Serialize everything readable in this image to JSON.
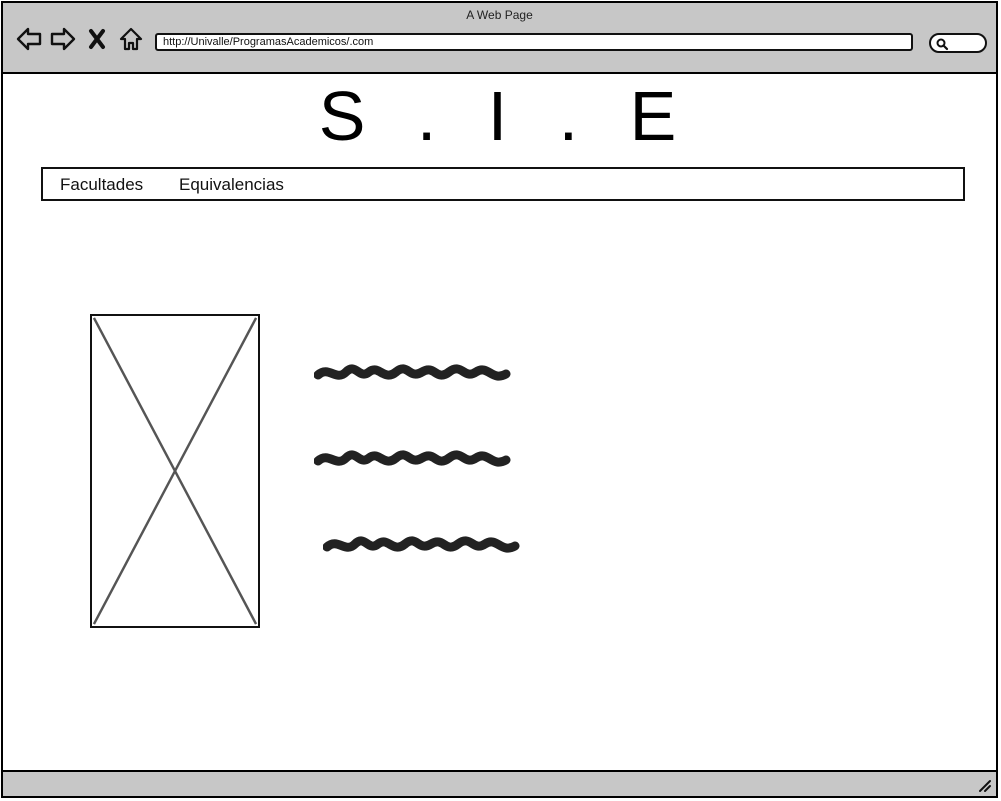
{
  "browser": {
    "window_title": "A Web Page",
    "url": "http://Univalle/ProgramasAcademicos/.com",
    "icons": [
      "back-arrow-icon",
      "forward-arrow-icon",
      "close-x-icon",
      "home-icon",
      "search-icon",
      "resize-grip-icon"
    ]
  },
  "page": {
    "logo_letters": [
      "S",
      ".",
      "I",
      ".",
      "E"
    ],
    "menu": {
      "items": [
        {
          "label": "Facultades"
        },
        {
          "label": "Equivalencias"
        }
      ]
    },
    "image_placeholder": "image-placeholder",
    "text_placeholders": [
      "scribble",
      "scribble",
      "scribble"
    ]
  }
}
